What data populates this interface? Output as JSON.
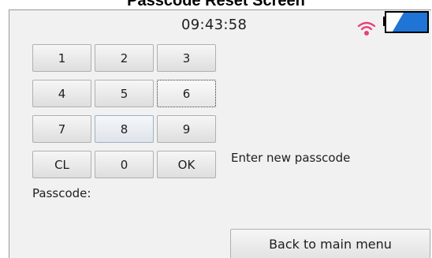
{
  "caption": "Passcode Reset Screen",
  "status_bar": {
    "time": "09:43:58",
    "wifi_icon": "wifi-icon",
    "wifi_color": "#e8407a",
    "battery_icon": "battery-icon",
    "battery_color": "#1f74d6"
  },
  "keypad": {
    "keys": [
      "1",
      "2",
      "3",
      "4",
      "5",
      "6",
      "7",
      "8",
      "9",
      "CL",
      "0",
      "OK"
    ],
    "selected_key": "6",
    "hovered_key": "8"
  },
  "message": "Enter new passcode",
  "passcode_label": "Passcode:",
  "passcode_value": "",
  "back_button_label": "Back to main menu"
}
